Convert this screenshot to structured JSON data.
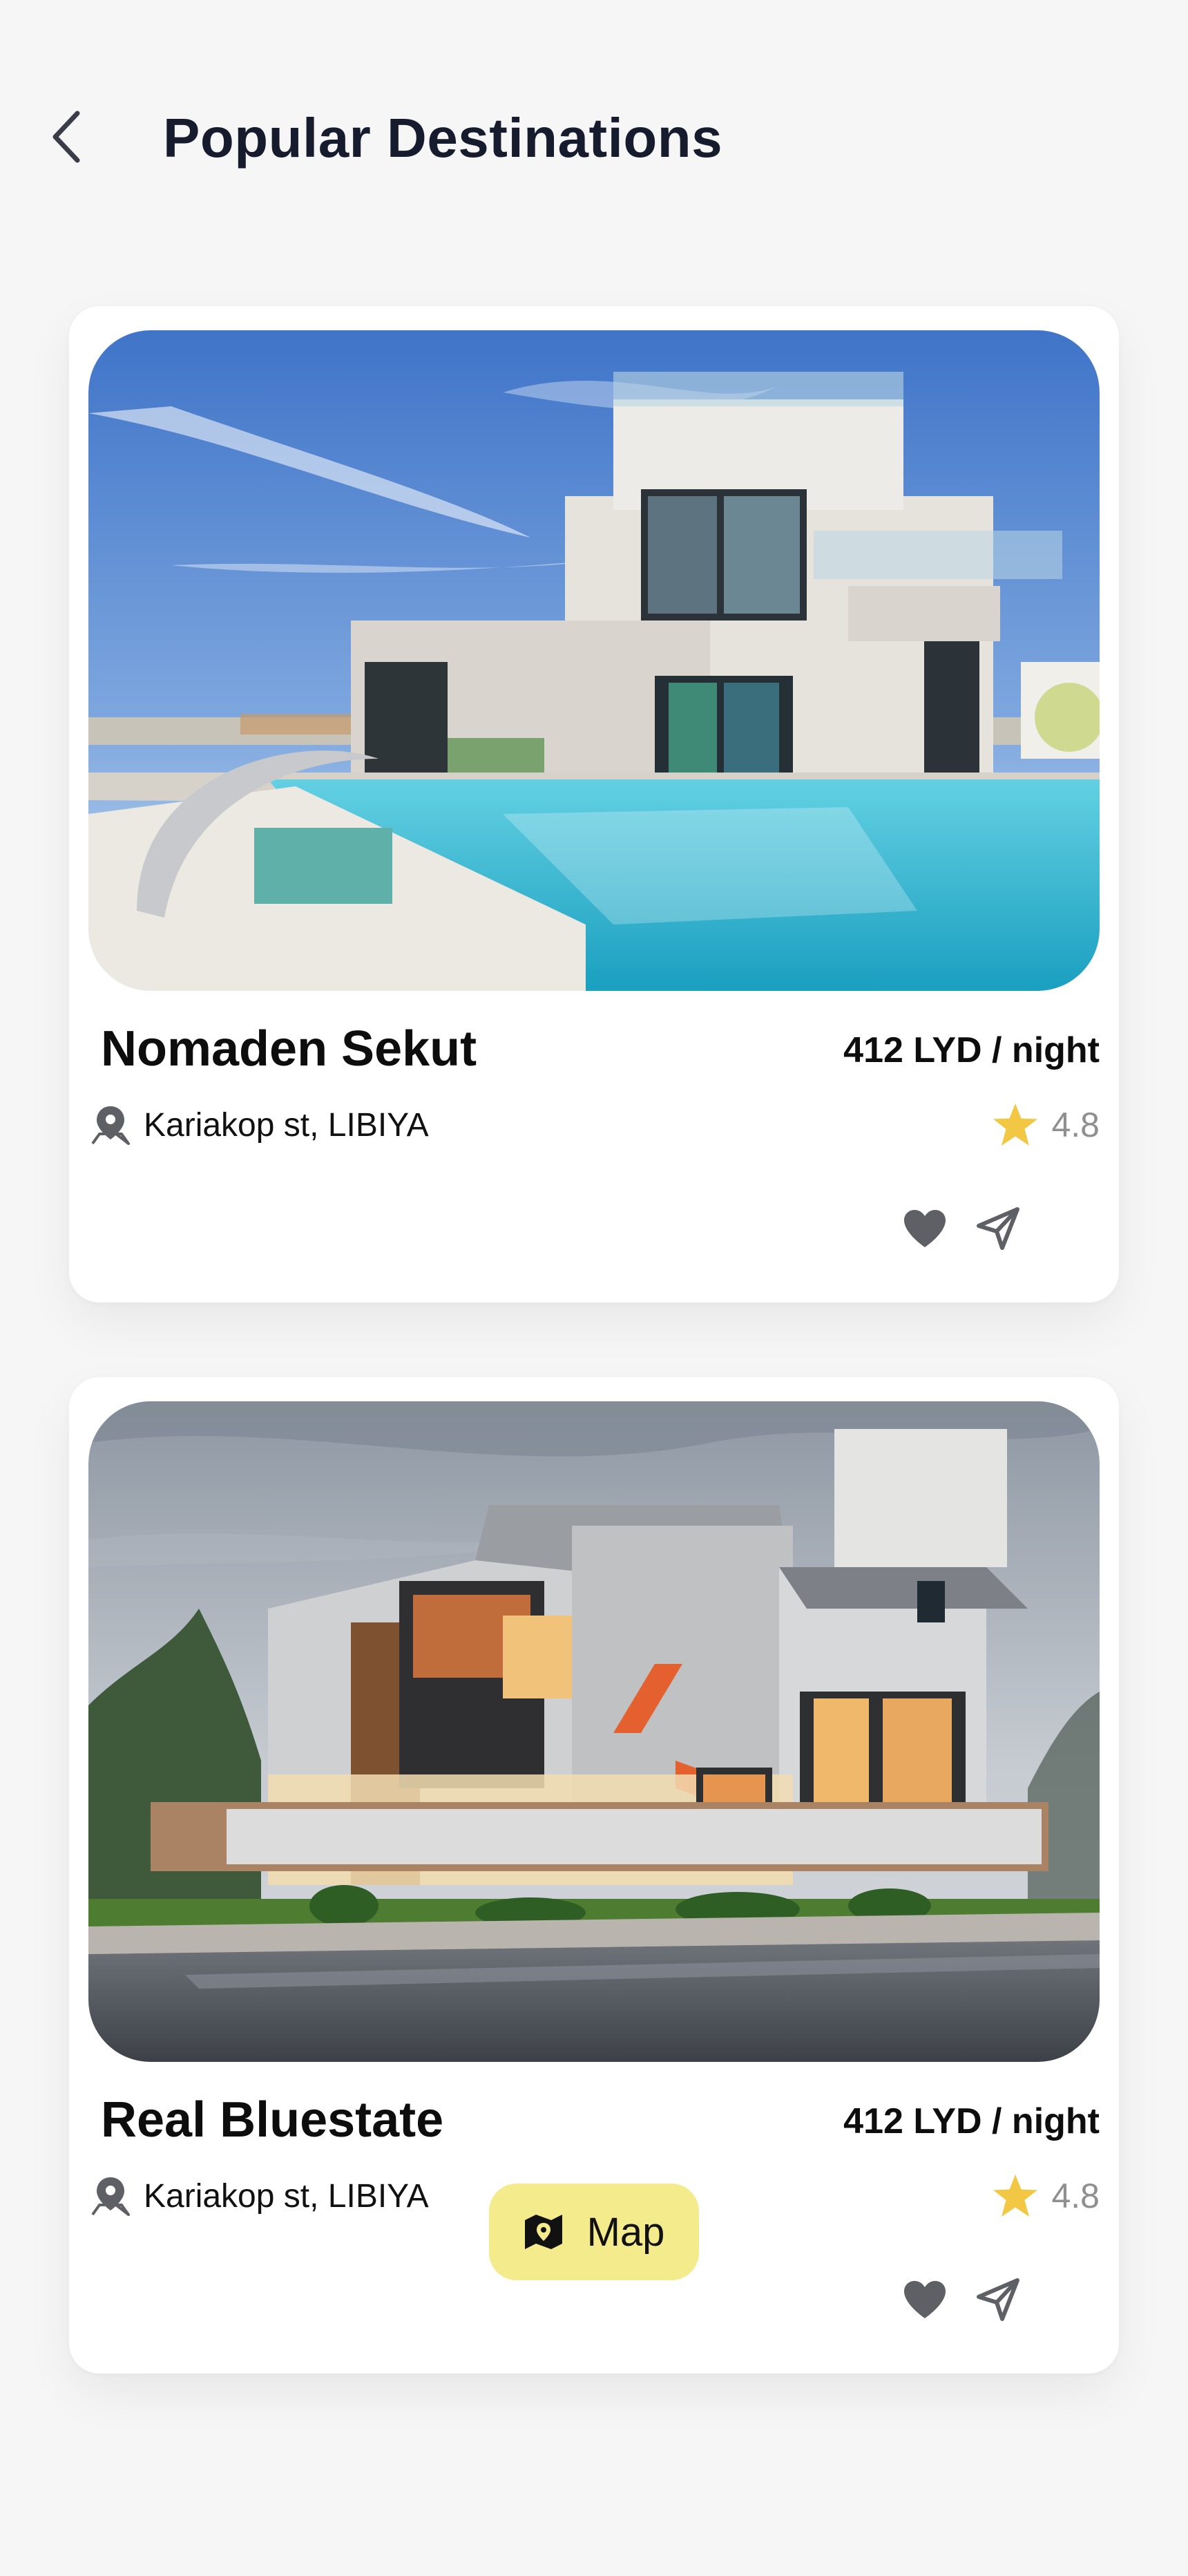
{
  "header": {
    "title": "Popular Destinations",
    "back_icon": "chevron-left-icon"
  },
  "listings": [
    {
      "name": "Nomaden Sekut",
      "price": "412 LYD / night",
      "location": "Kariakop st, LIBIYA",
      "rating": "4.8",
      "image": "modern white villa with swimming pool"
    },
    {
      "name": "Real Bluestate",
      "price": "412 LYD / night",
      "location": "Kariakop st, LIBIYA",
      "rating": "4.8",
      "image": "modern grey two-storey house at dusk"
    }
  ],
  "map_button": {
    "label": "Map",
    "icon": "map-icon"
  },
  "colors": {
    "background": "#f6f6f7",
    "card": "#ffffff",
    "title": "#171b2e",
    "star": "#f2c744",
    "icon_grey": "#5f6066",
    "map_button": "#f4ec8c"
  }
}
